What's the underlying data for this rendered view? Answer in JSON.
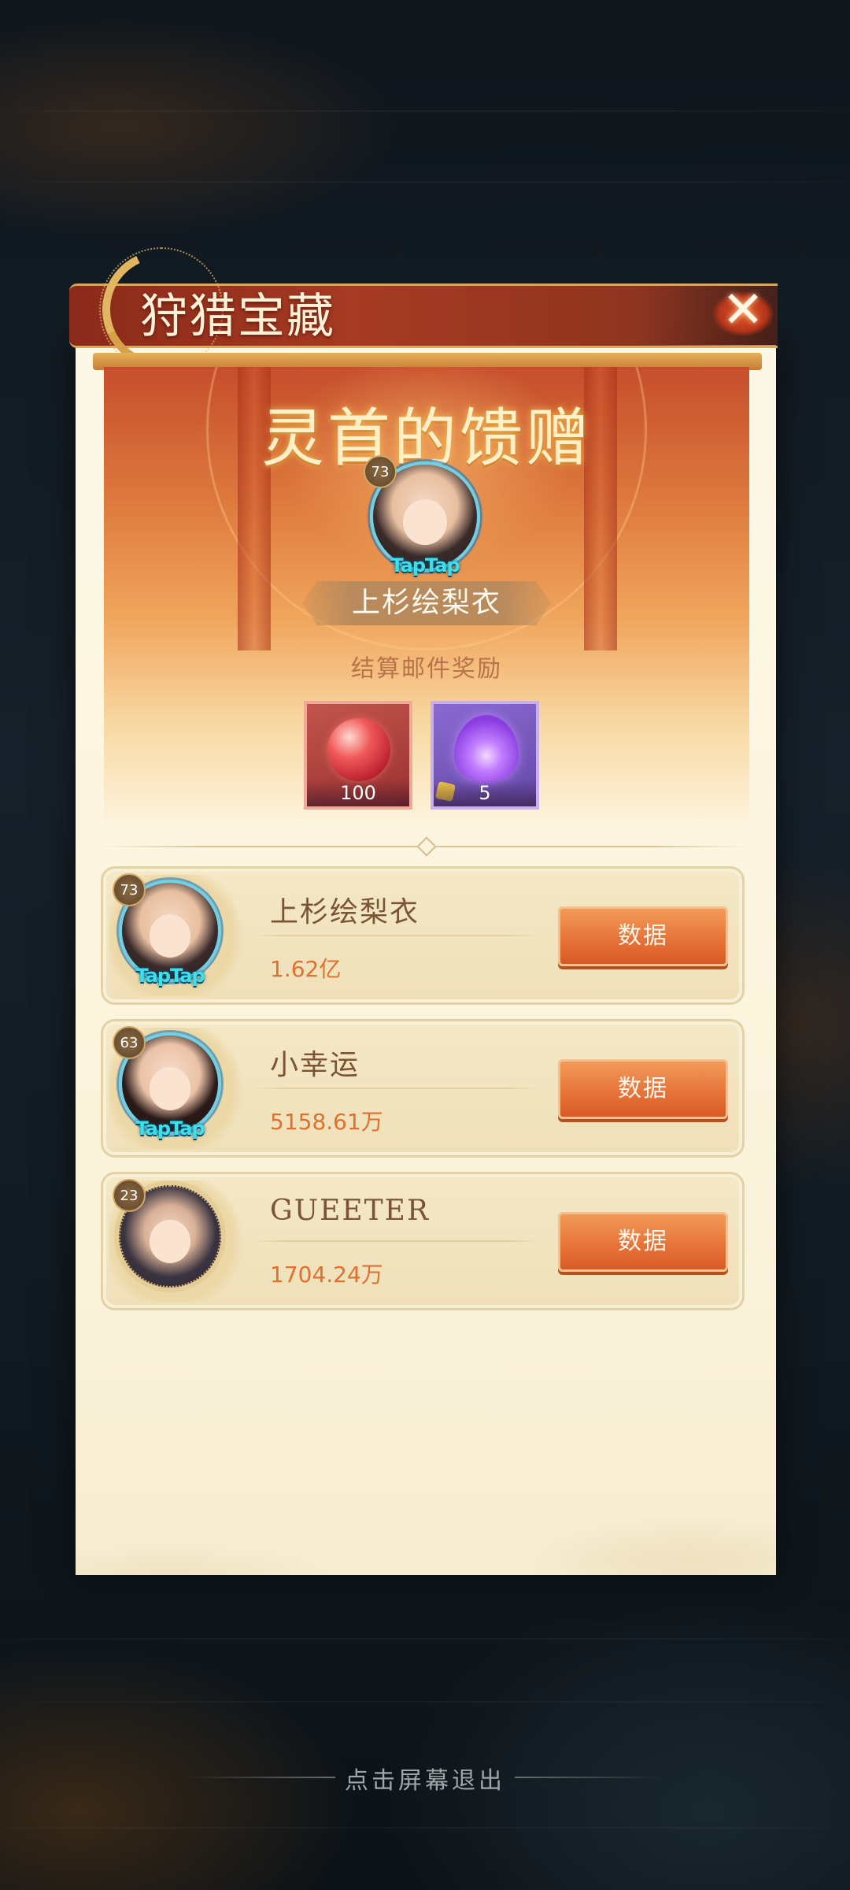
{
  "header": {
    "title": "狩猎宝藏",
    "close_icon": "close-icon"
  },
  "hero": {
    "title": "灵首的馈赠",
    "winner": {
      "level": "73",
      "name": "上杉绘梨衣",
      "badge_text": "TapTap"
    },
    "subtitle": "结算邮件奖励",
    "rewards": [
      {
        "icon": "red-orb-icon",
        "count": "100"
      },
      {
        "icon": "purple-flame-icon",
        "count": "5"
      }
    ]
  },
  "rankings": [
    {
      "level": "73",
      "name": "上杉绘梨衣",
      "value": "1.62亿",
      "badge_text": "TapTap",
      "button_label": "数据"
    },
    {
      "level": "63",
      "name": "小幸运",
      "value": "5158.61万",
      "badge_text": "TapTap",
      "button_label": "数据"
    },
    {
      "level": "23",
      "name": "GUEETER",
      "value": "1704.24万",
      "badge_text": "",
      "button_label": "数据"
    }
  ],
  "footer": {
    "exit_hint": "点击屏幕退出"
  },
  "colors": {
    "accent_orange": "#e7743a",
    "title_bar_red": "#a63a22",
    "panel_cream": "#fdf8e6"
  }
}
